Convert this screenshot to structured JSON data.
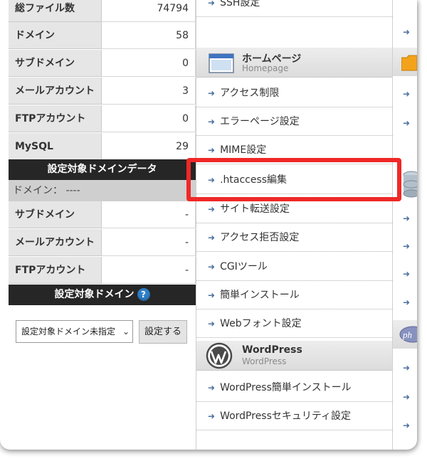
{
  "stats_top": [
    {
      "label": "総ファイル数",
      "value": "74794"
    },
    {
      "label": "ドメイン",
      "value": "58"
    },
    {
      "label": "サブドメイン",
      "value": "0"
    },
    {
      "label": "メールアカウント",
      "value": "3"
    },
    {
      "label": "FTPアカウント",
      "value": "0"
    },
    {
      "label": "MySQL",
      "value": "29"
    }
  ],
  "domain_data": {
    "header": "設定対象ドメインデータ",
    "domain_line": "ドメイン： ----",
    "rows": [
      {
        "label": "サブドメイン",
        "value": "-"
      },
      {
        "label": "メールアカウント",
        "value": "-"
      },
      {
        "label": "FTPアカウント",
        "value": "-"
      }
    ]
  },
  "target_domain": {
    "header": "設定対象ドメイン",
    "help_icon": "?",
    "select_value": "設定対象ドメイン未指定",
    "button_label": "設定する"
  },
  "menu": {
    "ssh_label": "SSH設定",
    "homepage_section": {
      "title": "ホームページ",
      "subtitle": "Homepage",
      "icon": "window-icon"
    },
    "homepage_items": [
      "アクセス制限",
      "エラーページ設定",
      "MIME設定",
      ".htaccess編集",
      "サイト転送設定",
      "アクセス拒否設定",
      "CGIツール",
      "簡単インストール",
      "Webフォント設定"
    ],
    "wordpress_section": {
      "title": "WordPress",
      "subtitle": "WordPress",
      "icon": "wordpress-icon"
    },
    "wordpress_items": [
      "WordPress簡単インストール",
      "WordPressセキュリティ設定"
    ]
  },
  "right_strip": {
    "php_label": "ph"
  },
  "colors": {
    "dark_bar": "#262626",
    "highlight": "#f02828",
    "arrow": "#4a6fa0",
    "help": "#2f7fc7"
  }
}
